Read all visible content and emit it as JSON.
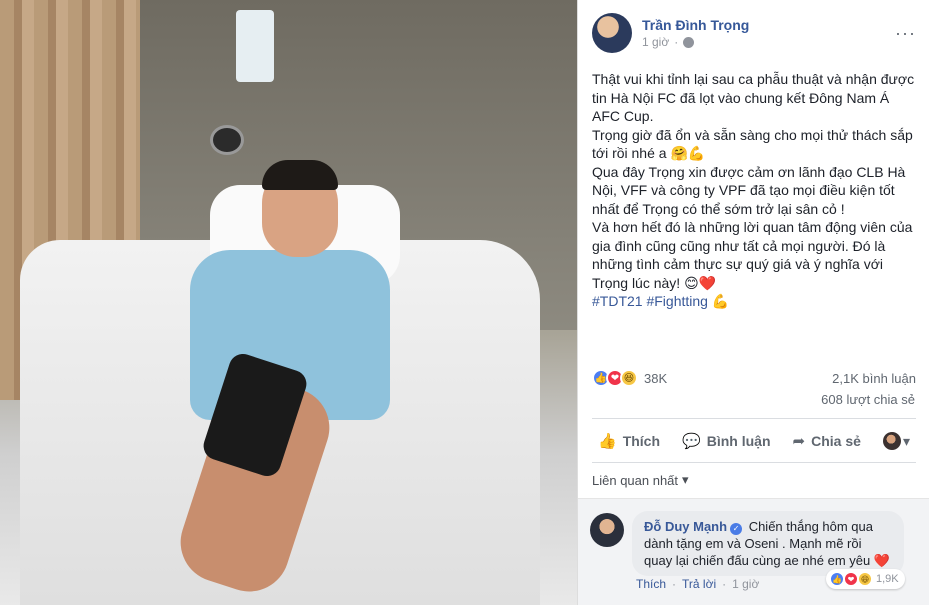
{
  "post": {
    "author": "Trần Đình Trọng",
    "time": "1 giờ",
    "more": "···",
    "paragraphs": [
      "Thật vui khi tỉnh lại sau ca phẫu thuật và nhận được tin Hà Nội FC đã lọt vào chung kết Đông Nam Á AFC Cup.",
      "Trọng giờ đã ổn và sẵn sàng cho mọi thử thách sắp tới rồi nhé a 🤗💪",
      "Qua đây Trọng xin được cảm ơn lãnh đạo CLB Hà Nội, VFF và công ty VPF đã tạo mọi điều kiện tốt nhất để Trọng có thể sớm trở lại sân cỏ !",
      "Và hơn hết đó là những lời quan tâm động viên của gia đình cũng cũng như tất cả mọi người. Đó là những tình cảm thực sự quý giá và ý nghĩa với Trọng lúc này! 😊❤️"
    ],
    "hashtags": "#TDT21 #Fightting",
    "hashtag_emoji": "💪"
  },
  "stats": {
    "reactions_count": "38K",
    "comments": "2,1K bình luận",
    "shares": "608 lượt chia sẻ"
  },
  "actions": {
    "like": "Thích",
    "comment": "Bình luận",
    "share": "Chia sẻ"
  },
  "sort": {
    "label": "Liên quan nhất"
  },
  "comment": {
    "author": "Đỗ Duy Mạnh",
    "text": "Chiến thắng hôm qua dành tặng em và Oseni . Mạnh mẽ rồi quay lại chiến đấu cùng ae nhé em yêu",
    "emoji": "❤️",
    "like": "Thích",
    "reply": "Trả lời",
    "time": "1 giờ",
    "reactions_count": "1,9K"
  },
  "icons": {
    "like": "👍",
    "love": "❤",
    "haha": "😆",
    "comment": "💬",
    "share": "➦",
    "caret": "▾"
  },
  "colors": {
    "link": "#365899",
    "text": "#1d2129",
    "muted": "#90949c",
    "like_blue": "#4c7ef3",
    "love_red": "#f0344a"
  }
}
